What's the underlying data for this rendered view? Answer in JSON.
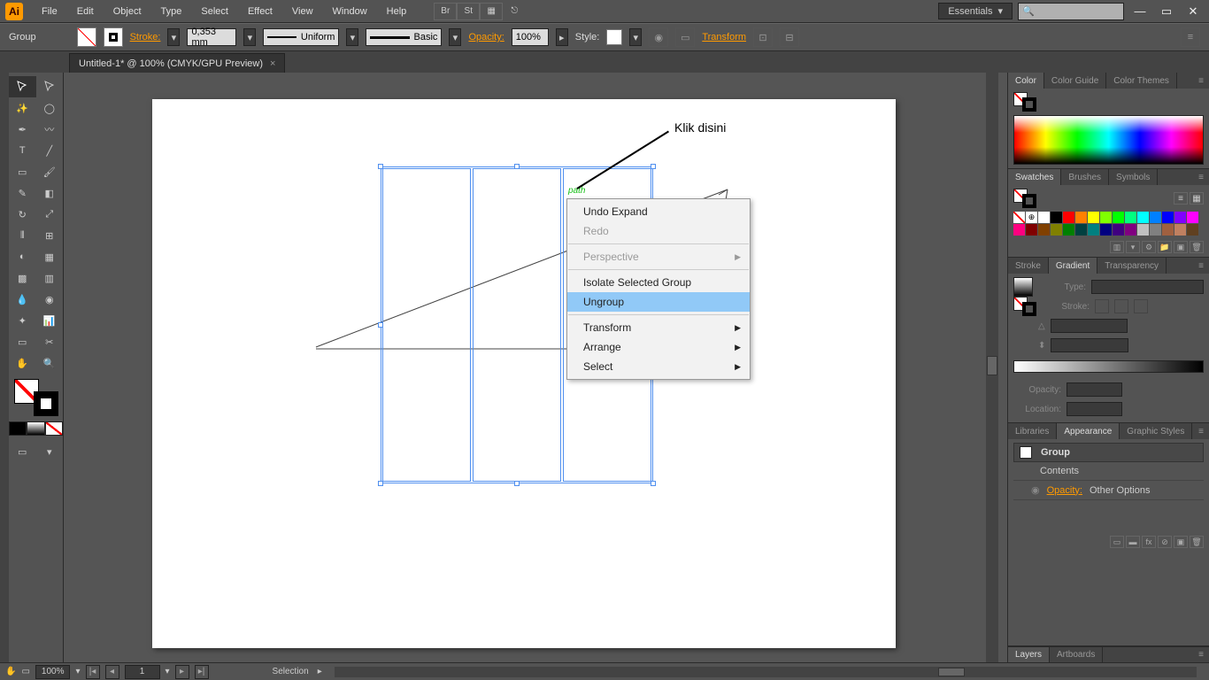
{
  "menubar": {
    "logo": "Ai",
    "items": [
      "File",
      "Edit",
      "Object",
      "Type",
      "Select",
      "Effect",
      "View",
      "Window",
      "Help"
    ],
    "br": "Br",
    "st": "St",
    "workspace": "Essentials"
  },
  "controlbar": {
    "selection_label": "Group",
    "stroke_label": "Stroke:",
    "stroke_val": "0,353 mm",
    "uniform": "Uniform",
    "basic": "Basic",
    "opacity_label": "Opacity:",
    "opacity_val": "100%",
    "style_label": "Style:",
    "transform": "Transform"
  },
  "tab": {
    "title": "Untitled-1* @ 100% (CMYK/GPU Preview)",
    "close": "×"
  },
  "canvas": {
    "annotation": "Klik disini",
    "path_label": "path"
  },
  "context_menu": {
    "items": [
      {
        "label": "Undo Expand",
        "disabled": false,
        "sub": false
      },
      {
        "label": "Redo",
        "disabled": true,
        "sub": false
      },
      {
        "sep": true
      },
      {
        "label": "Perspective",
        "disabled": true,
        "sub": true
      },
      {
        "sep": true
      },
      {
        "label": "Isolate Selected Group",
        "disabled": false,
        "sub": false
      },
      {
        "label": "Ungroup",
        "disabled": false,
        "sub": false,
        "hl": true
      },
      {
        "sep": true
      },
      {
        "label": "Transform",
        "disabled": false,
        "sub": true
      },
      {
        "label": "Arrange",
        "disabled": false,
        "sub": true
      },
      {
        "label": "Select",
        "disabled": false,
        "sub": true
      }
    ]
  },
  "panels": {
    "color": {
      "tabs": [
        "Color",
        "Color Guide",
        "Color Themes"
      ]
    },
    "swatches": {
      "tabs": [
        "Swatches",
        "Brushes",
        "Symbols"
      ],
      "colors": [
        "#ffffff",
        "#000000",
        "#ff0000",
        "#ff8000",
        "#ffff00",
        "#80ff00",
        "#00ff00",
        "#00ff80",
        "#00ffff",
        "#0080ff",
        "#0000ff",
        "#8000ff",
        "#ff00ff",
        "#ff0080",
        "#800000",
        "#804000",
        "#808000",
        "#008000",
        "#004040",
        "#008080",
        "#000080",
        "#400080",
        "#800080",
        "#c0c0c0",
        "#808080",
        "#a06040",
        "#c08060",
        "#604020"
      ]
    },
    "gradient": {
      "tabs": [
        "Stroke",
        "Gradient",
        "Transparency"
      ],
      "type_lbl": "Type:",
      "stroke_lbl": "Stroke:",
      "opacity_lbl": "Opacity:",
      "location_lbl": "Location:"
    },
    "appearance": {
      "tabs": [
        "Libraries",
        "Appearance",
        "Graphic Styles"
      ],
      "group": "Group",
      "contents": "Contents",
      "opacity": "Opacity:",
      "other": "Other Options"
    },
    "bottom": {
      "tabs": [
        "Layers",
        "Artboards"
      ]
    }
  },
  "statusbar": {
    "zoom": "100%",
    "artboard": "1",
    "mode": "Selection"
  },
  "swatch_nf_colors": []
}
